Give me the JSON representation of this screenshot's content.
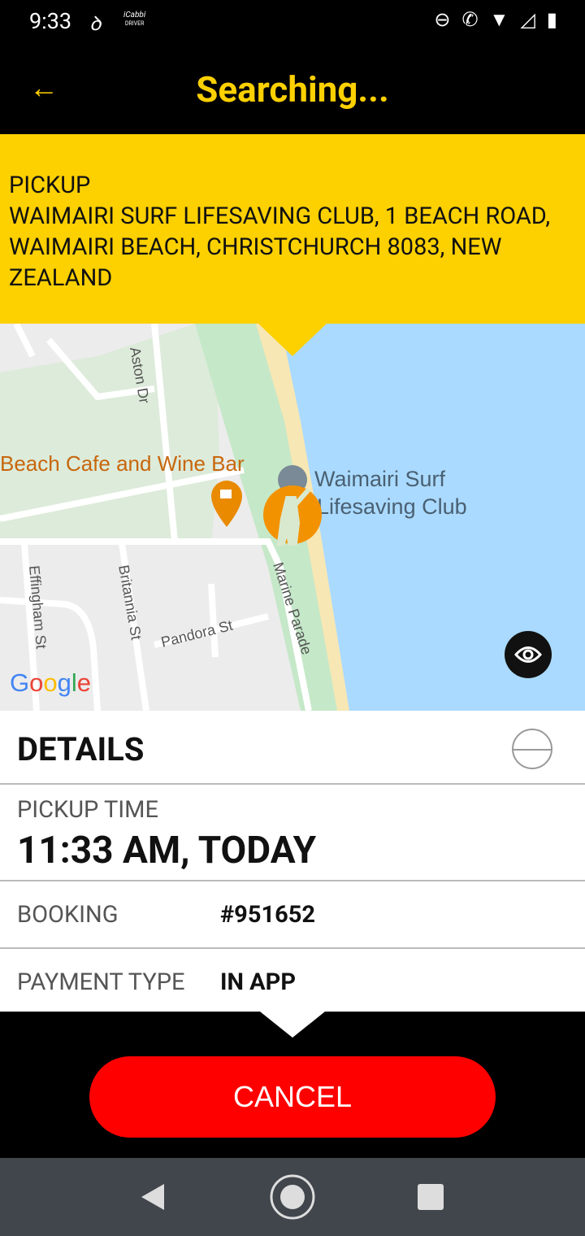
{
  "status_bar": {
    "time": "9:33",
    "app_label": "iCabbi",
    "app_sublabel": "DRIVER"
  },
  "app_bar": {
    "title": "Searching...",
    "back_icon": "arrow-left-icon"
  },
  "pickup": {
    "label": "PICKUP",
    "address": "WAIMAIRI SURF LIFESAVING CLUB, 1 BEACH ROAD, WAIMAIRI BEACH, CHRISTCHURCH 8083, NEW ZEALAND"
  },
  "map": {
    "poi_cafe": "Beach Cafe and Wine Bar",
    "poi_club_line1": "Waimairi Surf",
    "poi_club_line2": "Lifesaving Club",
    "streets": [
      "Aston Dr",
      "Effingham St",
      "Britannia St",
      "Pandora St",
      "Marine Parade"
    ],
    "logo": "Google"
  },
  "details": {
    "heading": "DETAILS",
    "pickup_time_label": "PICKUP TIME",
    "pickup_time": "11:33 AM, TODAY",
    "booking_label": "BOOKING",
    "booking": "#951652",
    "payment_label": "PAYMENT TYPE",
    "payment": "IN APP"
  },
  "actions": {
    "cancel": "CANCEL"
  },
  "colors": {
    "accent": "#fdd000",
    "cancel": "#fe0000"
  }
}
